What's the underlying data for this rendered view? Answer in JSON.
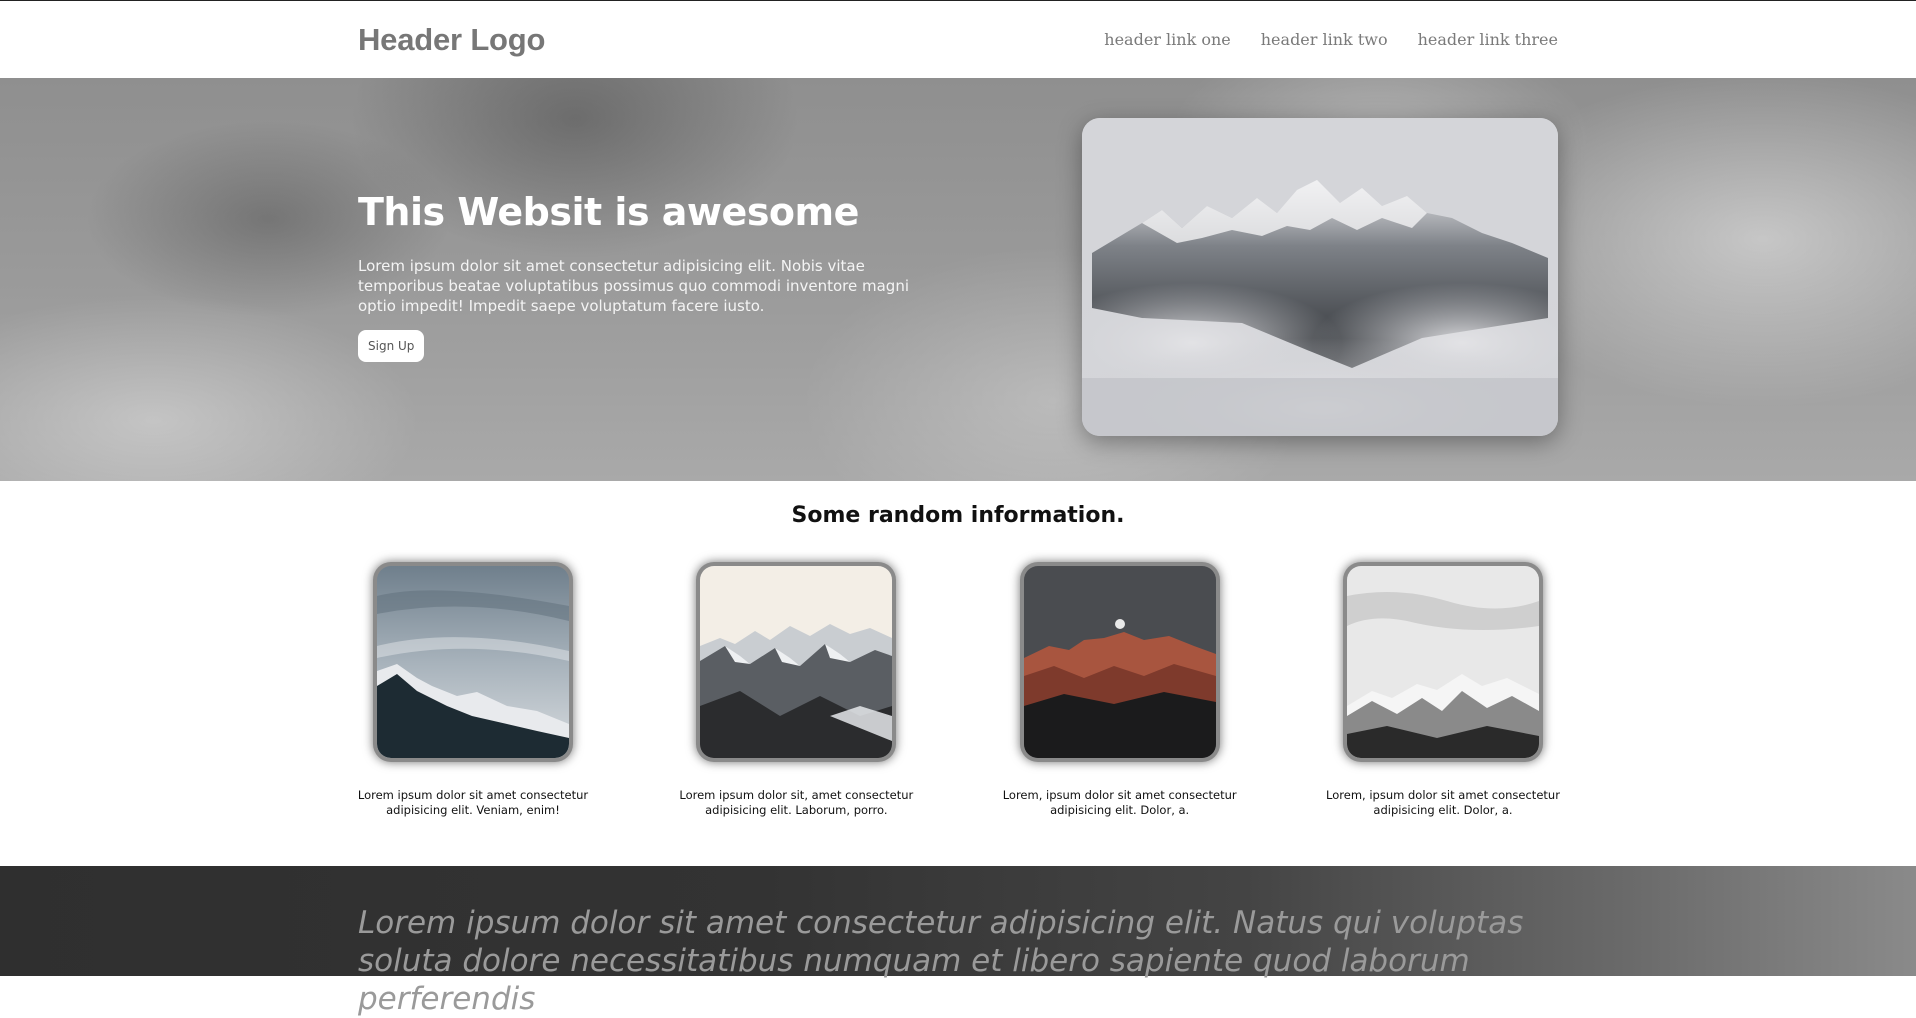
{
  "header": {
    "logo": "Header Logo",
    "links": [
      "header link one",
      "header link two",
      "header link three"
    ]
  },
  "hero": {
    "title": "This Websit is awesome",
    "description": "Lorem ipsum dolor sit amet consectetur adipisicing elit. Nobis vitae temporibus beatae voluptatibus possimus quo commodi inventore magni optio impedit! Impedit saepe voluptatum facere iusto.",
    "button": "Sign Up"
  },
  "info": {
    "title": "Some random information.",
    "cards": [
      {
        "text": "Lorem ipsum dolor sit amet consectetur adipisicing elit. Veniam, enim!"
      },
      {
        "text": "Lorem ipsum dolor sit, amet consectetur adipisicing elit. Laborum, porro."
      },
      {
        "text": "Lorem, ipsum dolor sit amet consectetur adipisicing elit. Dolor, a."
      },
      {
        "text": "Lorem, ipsum dolor sit amet consectetur adipisicing elit. Dolor, a."
      }
    ]
  },
  "band": {
    "text": "Lorem ipsum dolor sit amet consectetur adipisicing elit. Natus qui voluptas soluta dolore necessitatibus numquam et libero sapiente quod laborum perferendis"
  }
}
